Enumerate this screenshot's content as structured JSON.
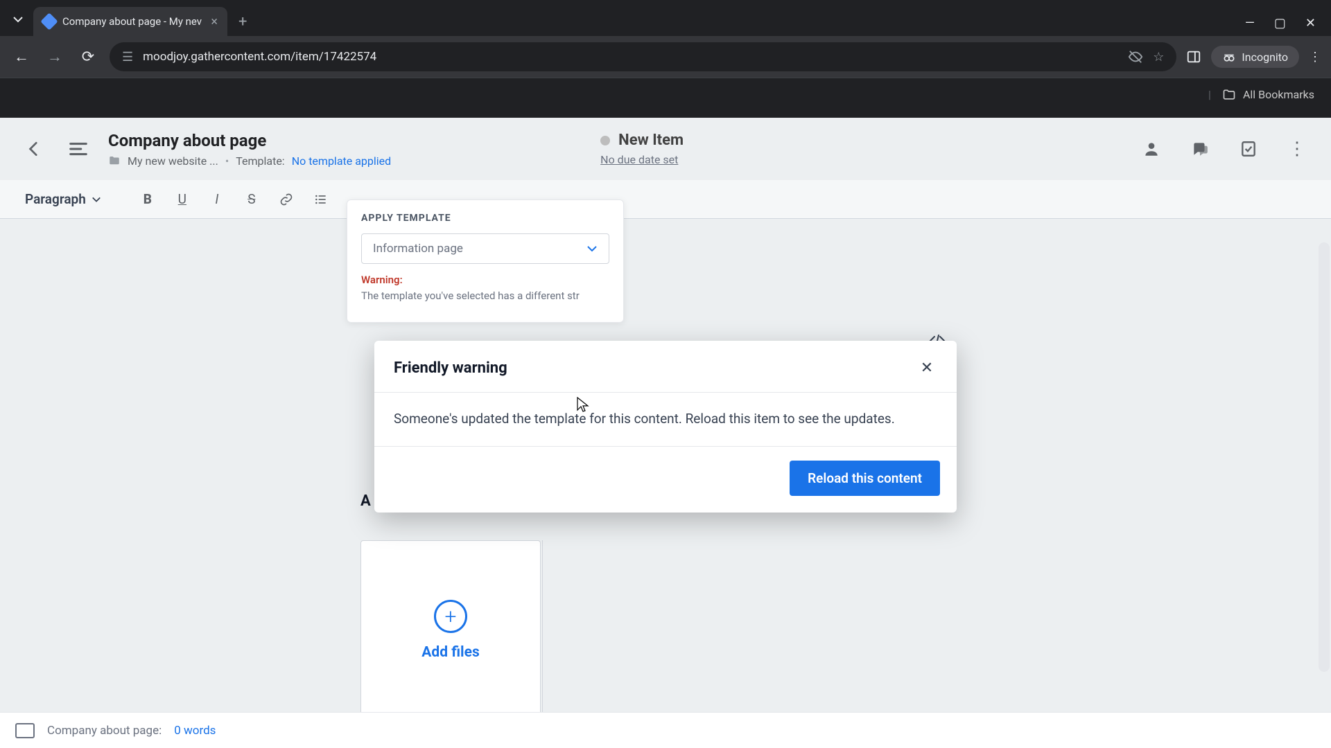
{
  "browser": {
    "tab_title": "Company about page - My nev",
    "url": "moodjoy.gathercontent.com/item/17422574",
    "incognito_label": "Incognito",
    "bookmarks_label": "All Bookmarks"
  },
  "header": {
    "title": "Company about page",
    "breadcrumb_folder": "My new website ...",
    "breadcrumb_template_label": "Template:",
    "breadcrumb_template_value": "No template applied",
    "status_label": "New Item",
    "due_date": "No due date set"
  },
  "toolbar": {
    "paragraph_label": "Paragraph"
  },
  "apply_popover": {
    "title": "APPLY TEMPLATE",
    "selected": "Information page",
    "warning_label": "Warning:",
    "warning_body": "The template you've selected has a different str"
  },
  "modal": {
    "title": "Friendly warning",
    "body": "Someone's updated the template for this content. Reload this item to see the updates.",
    "primary_button": "Reload this content"
  },
  "section": {
    "label_initial": "A"
  },
  "add_files": {
    "label": "Add files"
  },
  "footer": {
    "label_prefix": "Company about page:",
    "word_count": "0 words"
  }
}
